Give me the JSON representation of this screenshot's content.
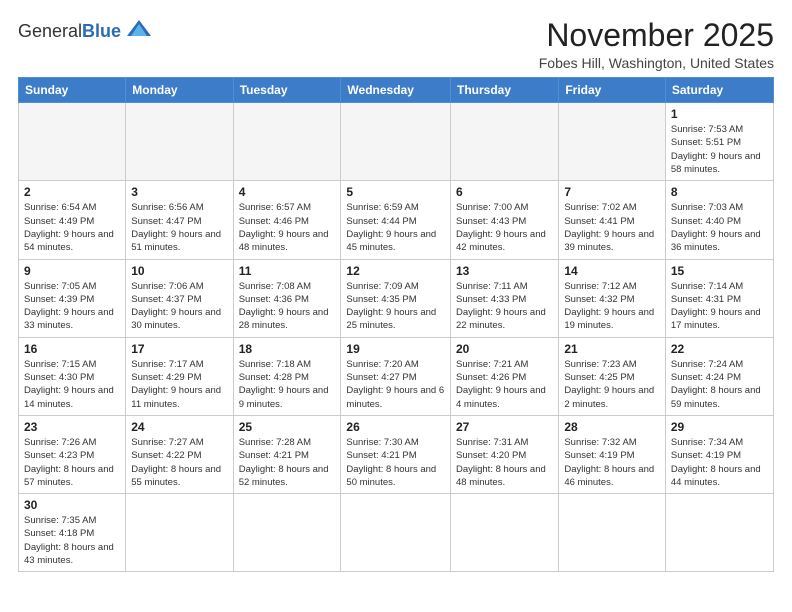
{
  "header": {
    "logo_general": "General",
    "logo_blue": "Blue",
    "title": "November 2025",
    "subtitle": "Fobes Hill, Washington, United States"
  },
  "weekdays": [
    "Sunday",
    "Monday",
    "Tuesday",
    "Wednesday",
    "Thursday",
    "Friday",
    "Saturday"
  ],
  "days": {
    "d1": {
      "num": "1",
      "rise": "7:53 AM",
      "set": "5:51 PM",
      "daylight": "9 hours and 58 minutes."
    },
    "d2": {
      "num": "2",
      "rise": "6:54 AM",
      "set": "4:49 PM",
      "daylight": "9 hours and 54 minutes."
    },
    "d3": {
      "num": "3",
      "rise": "6:56 AM",
      "set": "4:47 PM",
      "daylight": "9 hours and 51 minutes."
    },
    "d4": {
      "num": "4",
      "rise": "6:57 AM",
      "set": "4:46 PM",
      "daylight": "9 hours and 48 minutes."
    },
    "d5": {
      "num": "5",
      "rise": "6:59 AM",
      "set": "4:44 PM",
      "daylight": "9 hours and 45 minutes."
    },
    "d6": {
      "num": "6",
      "rise": "7:00 AM",
      "set": "4:43 PM",
      "daylight": "9 hours and 42 minutes."
    },
    "d7": {
      "num": "7",
      "rise": "7:02 AM",
      "set": "4:41 PM",
      "daylight": "9 hours and 39 minutes."
    },
    "d8": {
      "num": "8",
      "rise": "7:03 AM",
      "set": "4:40 PM",
      "daylight": "9 hours and 36 minutes."
    },
    "d9": {
      "num": "9",
      "rise": "7:05 AM",
      "set": "4:39 PM",
      "daylight": "9 hours and 33 minutes."
    },
    "d10": {
      "num": "10",
      "rise": "7:06 AM",
      "set": "4:37 PM",
      "daylight": "9 hours and 30 minutes."
    },
    "d11": {
      "num": "11",
      "rise": "7:08 AM",
      "set": "4:36 PM",
      "daylight": "9 hours and 28 minutes."
    },
    "d12": {
      "num": "12",
      "rise": "7:09 AM",
      "set": "4:35 PM",
      "daylight": "9 hours and 25 minutes."
    },
    "d13": {
      "num": "13",
      "rise": "7:11 AM",
      "set": "4:33 PM",
      "daylight": "9 hours and 22 minutes."
    },
    "d14": {
      "num": "14",
      "rise": "7:12 AM",
      "set": "4:32 PM",
      "daylight": "9 hours and 19 minutes."
    },
    "d15": {
      "num": "15",
      "rise": "7:14 AM",
      "set": "4:31 PM",
      "daylight": "9 hours and 17 minutes."
    },
    "d16": {
      "num": "16",
      "rise": "7:15 AM",
      "set": "4:30 PM",
      "daylight": "9 hours and 14 minutes."
    },
    "d17": {
      "num": "17",
      "rise": "7:17 AM",
      "set": "4:29 PM",
      "daylight": "9 hours and 11 minutes."
    },
    "d18": {
      "num": "18",
      "rise": "7:18 AM",
      "set": "4:28 PM",
      "daylight": "9 hours and 9 minutes."
    },
    "d19": {
      "num": "19",
      "rise": "7:20 AM",
      "set": "4:27 PM",
      "daylight": "9 hours and 6 minutes."
    },
    "d20": {
      "num": "20",
      "rise": "7:21 AM",
      "set": "4:26 PM",
      "daylight": "9 hours and 4 minutes."
    },
    "d21": {
      "num": "21",
      "rise": "7:23 AM",
      "set": "4:25 PM",
      "daylight": "9 hours and 2 minutes."
    },
    "d22": {
      "num": "22",
      "rise": "7:24 AM",
      "set": "4:24 PM",
      "daylight": "8 hours and 59 minutes."
    },
    "d23": {
      "num": "23",
      "rise": "7:26 AM",
      "set": "4:23 PM",
      "daylight": "8 hours and 57 minutes."
    },
    "d24": {
      "num": "24",
      "rise": "7:27 AM",
      "set": "4:22 PM",
      "daylight": "8 hours and 55 minutes."
    },
    "d25": {
      "num": "25",
      "rise": "7:28 AM",
      "set": "4:21 PM",
      "daylight": "8 hours and 52 minutes."
    },
    "d26": {
      "num": "26",
      "rise": "7:30 AM",
      "set": "4:21 PM",
      "daylight": "8 hours and 50 minutes."
    },
    "d27": {
      "num": "27",
      "rise": "7:31 AM",
      "set": "4:20 PM",
      "daylight": "8 hours and 48 minutes."
    },
    "d28": {
      "num": "28",
      "rise": "7:32 AM",
      "set": "4:19 PM",
      "daylight": "8 hours and 46 minutes."
    },
    "d29": {
      "num": "29",
      "rise": "7:34 AM",
      "set": "4:19 PM",
      "daylight": "8 hours and 44 minutes."
    },
    "d30": {
      "num": "30",
      "rise": "7:35 AM",
      "set": "4:18 PM",
      "daylight": "8 hours and 43 minutes."
    }
  }
}
